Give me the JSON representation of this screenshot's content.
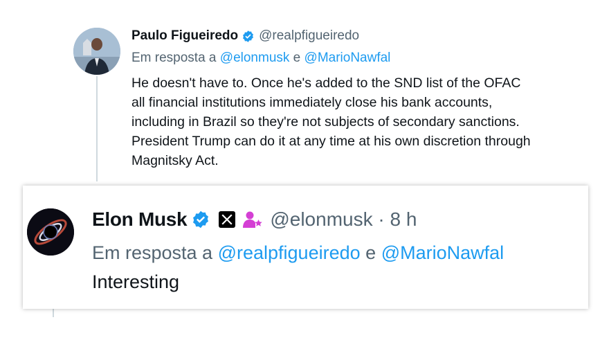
{
  "tweet1": {
    "author_name": "Paulo Figueiredo",
    "handle": "@realpfigueiredo",
    "reply_prefix": "Em resposta a",
    "reply_mention1": "@elonmusk",
    "reply_joiner": "e",
    "reply_mention2": "@MarioNawfal",
    "text": "He doesn't have to. Once he's added to the SND list of the OFAC all financial institutions immediately close his bank accounts, including in Brazil so they're not subjects of secondary sanctions. President Trump can do it at any time at his own discretion through Magnitsky Act.",
    "verified_icon": "verified-badge-icon",
    "verified_color": "#1d9bf0"
  },
  "tweet2": {
    "author_name": "Elon Musk",
    "handle": "@elonmusk",
    "separator": "·",
    "time": "8 h",
    "reply_prefix": "Em resposta a",
    "reply_mention1": "@realpfigueiredo",
    "reply_joiner": "e",
    "reply_mention2": "@MarioNawfal",
    "text": "Interesting",
    "verified_icon": "verified-badge-icon",
    "affiliate_icon": "x-affiliate-icon",
    "role_icon": "person-star-icon",
    "role_icon_color": "#d43fd4"
  },
  "colors": {
    "mention": "#1d9bf0",
    "secondary_text": "#536471",
    "primary_text": "#0f1419"
  }
}
